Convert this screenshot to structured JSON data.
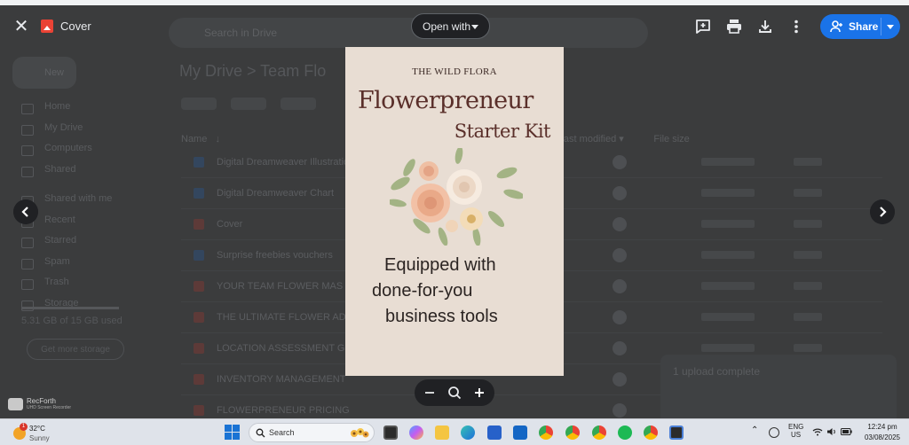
{
  "viewer": {
    "file_title": "Cover",
    "open_with_label": "Open with",
    "share_label": "Share"
  },
  "document": {
    "brand": "THE WILD FLORA",
    "title_line1": "Flowerpreneur",
    "title_line2": "Starter Kit",
    "tagline": [
      "Equipped with",
      "done-for-you",
      "business tools"
    ]
  },
  "zoom": {
    "zoom_out_icon": "minus-icon",
    "zoom_icon": "magnifier-icon",
    "zoom_in_icon": "plus-icon"
  },
  "background_drive": {
    "search_placeholder": "Search in Drive",
    "new_label": "New",
    "nav": [
      "Home",
      "My Drive",
      "Computers",
      "Shared",
      "Shared with me",
      "Recent",
      "Starred",
      "Spam",
      "Trash",
      "Storage"
    ],
    "breadcrumb": "My Drive  >  Team Flo",
    "storage_text": "5.31 GB of 15 GB used",
    "get_storage_label": "Get more storage",
    "columns": "Name   ↓                                                                                              Owner                    Last modified ▾           File size",
    "rows": [
      "Digital Dreamweaver Illustration",
      "Digital Dreamweaver Chart",
      "Cover",
      "Surprise freebies vouchers",
      "YOUR TEAM FLOWER MAS",
      "THE ULTIMATE FLOWER AD",
      "LOCATION ASSESSMENT GU",
      "INVENTORY MANAGEMENT",
      "FLOWERPRENEUR PRICING CALCULATOR"
    ],
    "upload_title": "1 upload complete"
  },
  "recorder": {
    "name": "RecForth",
    "sub": "UHD Screen Recorder"
  },
  "taskbar": {
    "temperature": "32°C",
    "weather": "Sunny",
    "weather_badge": "1",
    "search_label": "Search",
    "lang_line1": "ENG",
    "lang_line2": "US",
    "time": "12:24 pm",
    "date": "03/08/2025"
  },
  "colors": {
    "accent_share": "#1a73e8",
    "viewer_bg": "#3b3c3d",
    "doc_bg": "#e8ddd3",
    "doc_title": "#5a2f2a"
  }
}
